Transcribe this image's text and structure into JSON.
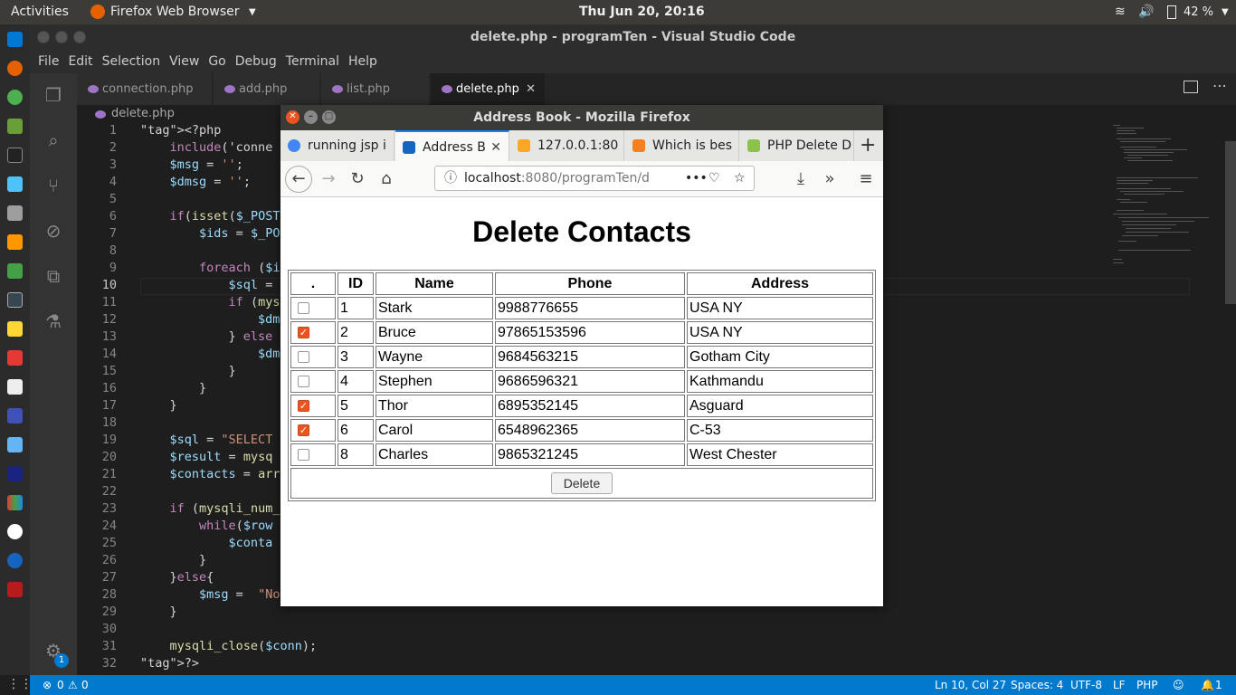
{
  "topbar": {
    "activities": "Activities",
    "app": "Firefox Web Browser",
    "clock": "Thu Jun 20, 20:16",
    "battery": "42 %"
  },
  "vscode": {
    "window_title": "delete.php - programTen - Visual Studio Code",
    "menu": [
      "File",
      "Edit",
      "Selection",
      "View",
      "Go",
      "Debug",
      "Terminal",
      "Help"
    ],
    "tabs": [
      {
        "label": "connection.php"
      },
      {
        "label": "add.php"
      },
      {
        "label": "list.php"
      },
      {
        "label": "delete.php",
        "active": true
      }
    ],
    "breadcrumb": "delete.php",
    "code_lines": [
      {
        "n": "1",
        "t": "<?php"
      },
      {
        "n": "2",
        "t": "    include('conne"
      },
      {
        "n": "3",
        "t": "    $msg = '';"
      },
      {
        "n": "4",
        "t": "    $dmsg = '';"
      },
      {
        "n": "5",
        "t": ""
      },
      {
        "n": "6",
        "t": "    if(isset($_POST"
      },
      {
        "n": "7",
        "t": "        $ids = $_PO"
      },
      {
        "n": "8",
        "t": ""
      },
      {
        "n": "9",
        "t": "        foreach ($i"
      },
      {
        "n": "10",
        "t": "            $sql ="
      },
      {
        "n": "11",
        "t": "            if (mys"
      },
      {
        "n": "12",
        "t": "                $dm"
      },
      {
        "n": "13",
        "t": "            } else"
      },
      {
        "n": "14",
        "t": "                $dm"
      },
      {
        "n": "15",
        "t": "            }"
      },
      {
        "n": "16",
        "t": "        }"
      },
      {
        "n": "17",
        "t": "    }"
      },
      {
        "n": "18",
        "t": ""
      },
      {
        "n": "19",
        "t": "    $sql = \"SELECT"
      },
      {
        "n": "20",
        "t": "    $result = mysq"
      },
      {
        "n": "21",
        "t": "    $contacts = arr"
      },
      {
        "n": "22",
        "t": ""
      },
      {
        "n": "23",
        "t": "    if (mysqli_num_"
      },
      {
        "n": "24",
        "t": "        while($row"
      },
      {
        "n": "25",
        "t": "            $conta"
      },
      {
        "n": "26",
        "t": "        }"
      },
      {
        "n": "27",
        "t": "    }else{"
      },
      {
        "n": "28",
        "t": "        $msg =  \"No"
      },
      {
        "n": "29",
        "t": "    }"
      },
      {
        "n": "30",
        "t": ""
      },
      {
        "n": "31",
        "t": "    mysqli_close($conn);"
      },
      {
        "n": "32",
        "t": "?>"
      }
    ],
    "status": {
      "errors": "0",
      "warnings": "0",
      "position": "Ln 10, Col 27",
      "spaces": "Spaces: 4",
      "encoding": "UTF-8",
      "eol": "LF",
      "language": "PHP",
      "notifications": "1"
    },
    "settings_badge": "1"
  },
  "firefox": {
    "window_title": "Address Book - Mozilla Firefox",
    "tabs": [
      {
        "label": "running jsp i"
      },
      {
        "label": "Address B",
        "active": true
      },
      {
        "label": "127.0.0.1:80"
      },
      {
        "label": "Which is bes"
      },
      {
        "label": "PHP Delete D"
      }
    ],
    "url_host": "localhost",
    "url_rest": ":8080/programTen/d"
  },
  "page": {
    "heading": "Delete Contacts",
    "columns": [
      ".",
      "ID",
      "Name",
      "Phone",
      "Address"
    ],
    "rows": [
      {
        "checked": false,
        "id": "1",
        "name": "Stark",
        "phone": "9988776655",
        "address": "USA NY"
      },
      {
        "checked": true,
        "id": "2",
        "name": "Bruce",
        "phone": "97865153596",
        "address": "USA NY"
      },
      {
        "checked": false,
        "id": "3",
        "name": "Wayne",
        "phone": "9684563215",
        "address": "Gotham City"
      },
      {
        "checked": false,
        "id": "4",
        "name": "Stephen",
        "phone": "9686596321",
        "address": "Kathmandu"
      },
      {
        "checked": true,
        "id": "5",
        "name": "Thor",
        "phone": "6895352145",
        "address": "Asguard"
      },
      {
        "checked": true,
        "id": "6",
        "name": "Carol",
        "phone": "6548962365",
        "address": "C-53"
      },
      {
        "checked": false,
        "id": "8",
        "name": "Charles",
        "phone": "9865321245",
        "address": "West Chester"
      }
    ],
    "delete_label": "Delete"
  },
  "colors": {
    "accent": "#007acc",
    "checkbox": "#e95420",
    "php_icon": "#a074c4"
  }
}
